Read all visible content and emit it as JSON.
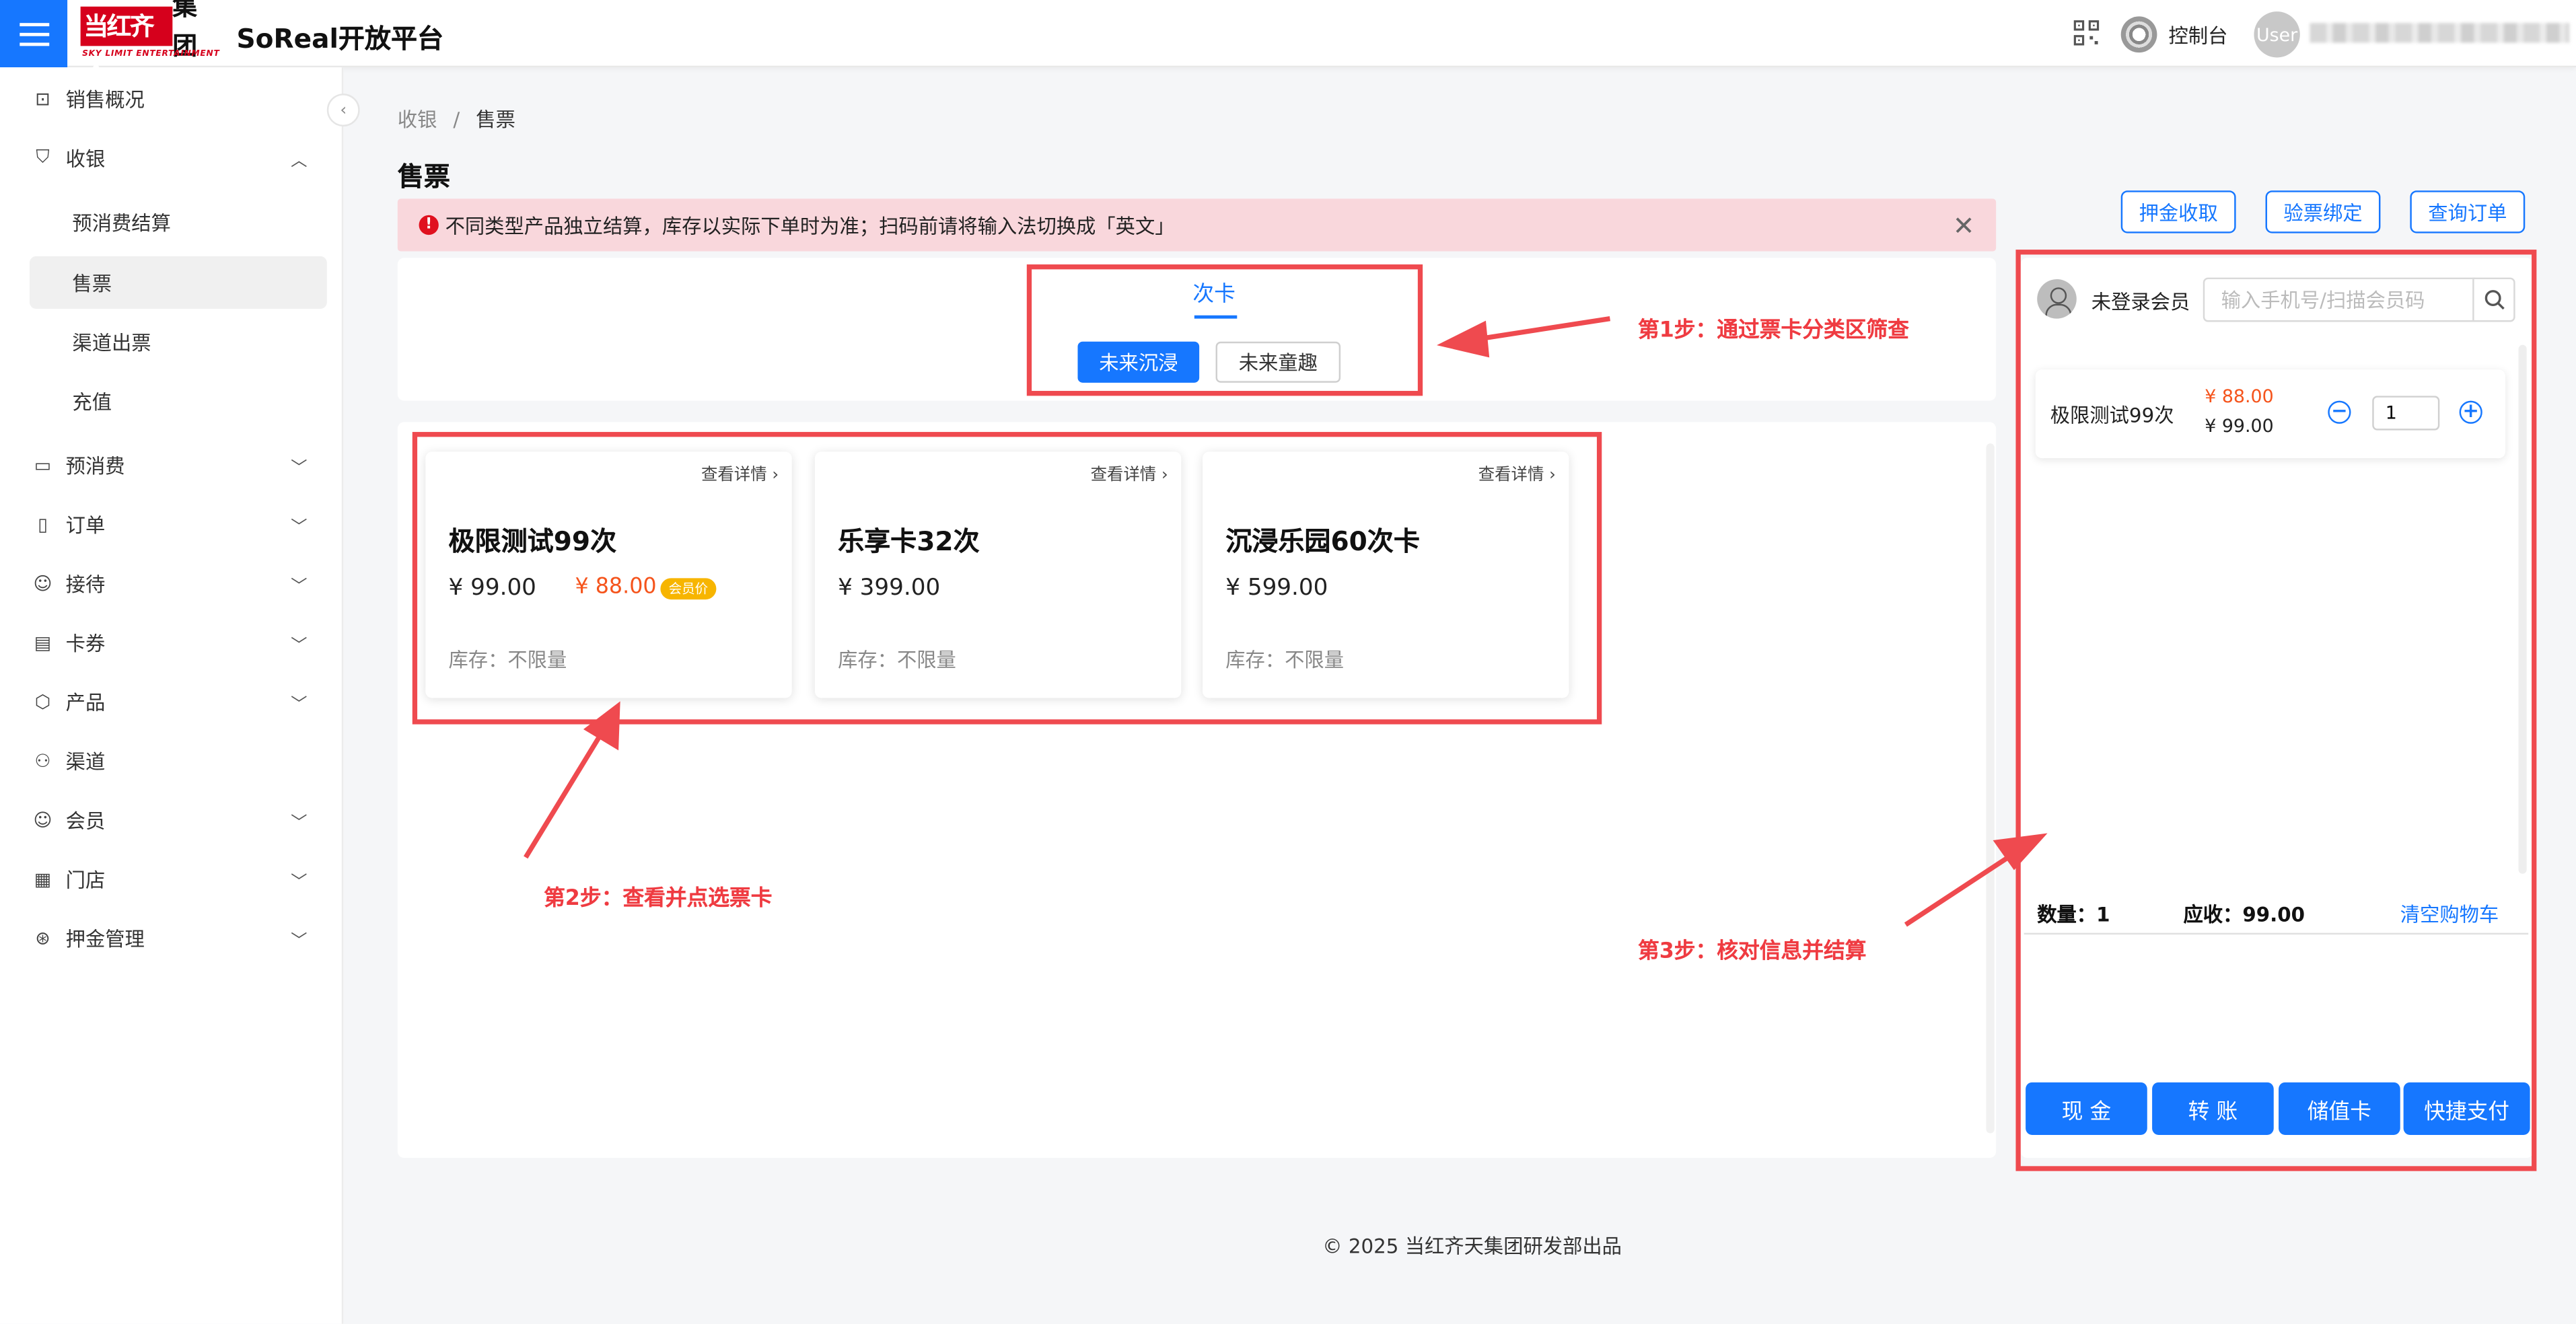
{
  "header": {
    "logo_main_red": "当红齐天",
    "logo_main_black": "集团",
    "logo_sub": "SKY LIMIT ENTERTAINMENT",
    "app_title": "SoReal开放平台",
    "console_label": "控制台",
    "avatar_text": "User"
  },
  "sidebar": {
    "items": [
      {
        "label": "销售概况",
        "icon": "chart-icon"
      },
      {
        "label": "收银",
        "icon": "shield-icon"
      },
      {
        "label": "预消费结算"
      },
      {
        "label": "售票"
      },
      {
        "label": "渠道出票"
      },
      {
        "label": "充值"
      },
      {
        "label": "预消费",
        "icon": "folder-icon"
      },
      {
        "label": "订单",
        "icon": "file-icon"
      },
      {
        "label": "接待",
        "icon": "user-icon"
      },
      {
        "label": "卡券",
        "icon": "id-card-icon"
      },
      {
        "label": "产品",
        "icon": "cube-icon"
      },
      {
        "label": "渠道",
        "icon": "hierarchy-icon"
      },
      {
        "label": "会员",
        "icon": "members-icon"
      },
      {
        "label": "门店",
        "icon": "store-icon"
      },
      {
        "label": "押金管理",
        "icon": "deposit-icon"
      }
    ]
  },
  "breadcrumb": {
    "parent": "收银",
    "separator": "/",
    "current": "售票"
  },
  "page_title": "售票",
  "alert": {
    "text": "不同类型产品独立结算，库存以实际下单时为准；扫码前请将输入法切换成「英文」"
  },
  "filter": {
    "tab": "次卡",
    "chips": [
      "未来沉浸",
      "未来童趣"
    ],
    "selected": "未来沉浸"
  },
  "products": [
    {
      "detail": "查看详情",
      "name": "极限测试99次",
      "price": "¥ 99.00",
      "member_price": "¥ 88.00",
      "member_tag": "会员价",
      "stock": "库存：不限量"
    },
    {
      "detail": "查看详情",
      "name": "乐享卡32次",
      "price": "¥ 399.00",
      "stock": "库存：不限量"
    },
    {
      "detail": "查看详情",
      "name": "沉浸乐园60次卡",
      "price": "¥ 599.00",
      "stock": "库存：不限量"
    }
  ],
  "right_actions": [
    "押金收取",
    "验票绑定",
    "查询订单"
  ],
  "cart": {
    "member_label": "未登录会员",
    "search_placeholder": "输入手机号/扫描会员码",
    "item": {
      "name": "极限测试99次",
      "member_price": "¥ 88.00",
      "price": "¥ 99.00",
      "qty": "1"
    },
    "qty_label": "数量：1",
    "receivable_label": "应收：99.00",
    "clear_label": "清空购物车",
    "pay_buttons": [
      "现 金",
      "转 账",
      "储值卡",
      "快捷支付"
    ]
  },
  "annotations": {
    "step1": "第1步：通过票卡分类区筛查",
    "step2": "第2步：查看并点选票卡",
    "step3": "第3步：核对信息并结算"
  },
  "footer": "© 2025 当红齐天集团研发部出品",
  "colors": {
    "accent": "#1677ff",
    "brand_red": "#d6001c",
    "annotation_red": "#ef4a4f",
    "member_price": "#f5541c"
  }
}
